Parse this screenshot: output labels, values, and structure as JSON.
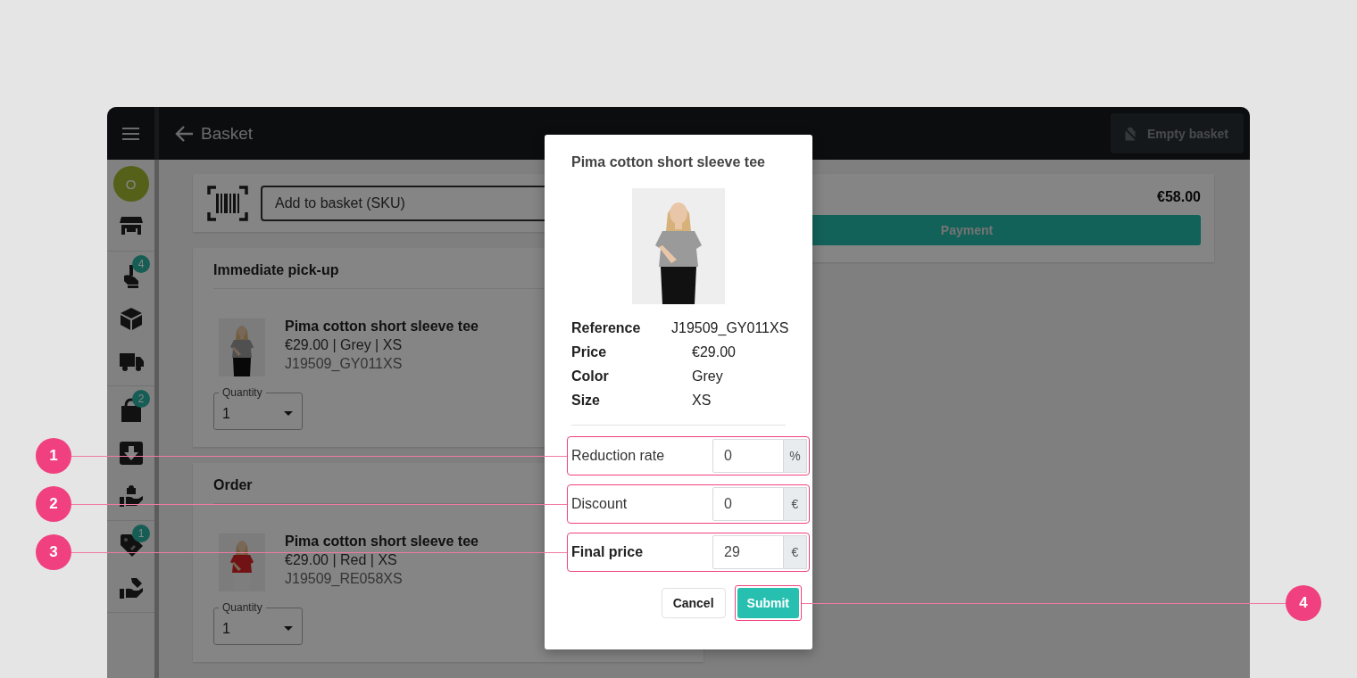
{
  "app_bar": {
    "title": "Basket",
    "empty_basket_button": "Empty basket"
  },
  "sidebar": {
    "avatar": "O",
    "badge_counts": [
      "4",
      "2",
      "1"
    ]
  },
  "sku_field": {
    "placeholder": "Add to basket (SKU)"
  },
  "sections": [
    {
      "title": "Immediate pick-up",
      "items": [
        {
          "kind": "picture",
          "name": "Pima cotton short sleeve tee",
          "details": "€29.00 | Grey | XS",
          "sku": "J19509_GY011XS",
          "quantity_label": "Quantity",
          "quantity": "1"
        }
      ]
    },
    {
      "title": "Order",
      "items": [
        {
          "kind": "picture",
          "name": "Pima cotton short sleeve tee",
          "details": "€29.00 | Red | XS",
          "sku": "J19509_RE058XS",
          "quantity_label": "Quantity",
          "quantity": "1"
        }
      ]
    }
  ],
  "summary": {
    "total": "€58.00",
    "payment_button": "Payment"
  },
  "dialog": {
    "title": "Pima cotton short sleeve tee",
    "details": [
      {
        "label": "Reference",
        "value": "J19509_GY011XS"
      },
      {
        "label": "Price",
        "value": "€29.00"
      },
      {
        "label": "Color",
        "value": "Grey"
      },
      {
        "label": "Size",
        "value": "XS"
      }
    ],
    "fields": [
      {
        "label": "Reduction rate",
        "value": "0",
        "unit": "%",
        "emphasized": false,
        "callout": "1"
      },
      {
        "label": "Discount",
        "value": "0",
        "unit": "€",
        "emphasized": false,
        "callout": "2"
      },
      {
        "label": "Final price",
        "value": "29",
        "unit": "€",
        "emphasized": true,
        "callout": "3"
      }
    ],
    "cancel_button": "Cancel",
    "submit_button": "Submit",
    "submit_callout": "4"
  }
}
